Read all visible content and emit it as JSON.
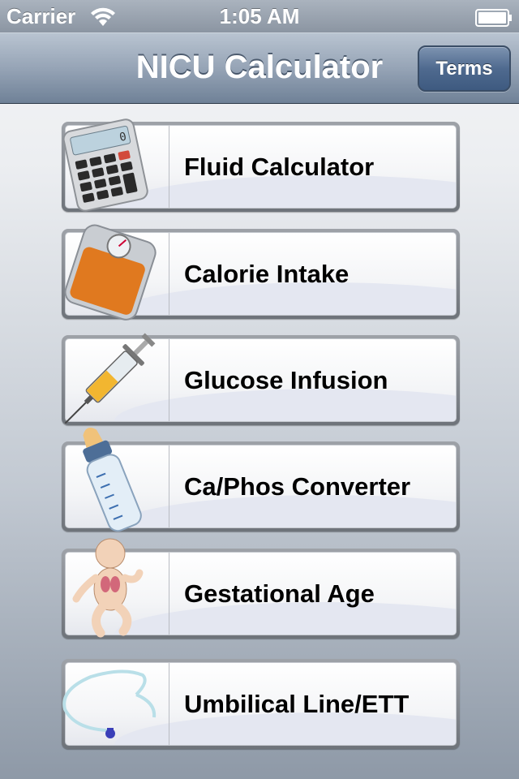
{
  "status_bar": {
    "carrier": "Carrier",
    "time": "1:05 AM"
  },
  "nav": {
    "title": "NICU Calculator",
    "terms_label": "Terms"
  },
  "menu": {
    "items": [
      {
        "label": "Fluid Calculator",
        "icon": "calculator-icon"
      },
      {
        "label": "Calorie Intake",
        "icon": "scale-icon"
      },
      {
        "label": "Glucose Infusion",
        "icon": "syringe-icon"
      },
      {
        "label": "Ca/Phos Converter",
        "icon": "baby-bottle-icon"
      },
      {
        "label": "Gestational Age",
        "icon": "baby-icon"
      },
      {
        "label": "Umbilical Line/ETT",
        "icon": "catheter-icon"
      }
    ]
  },
  "colors": {
    "nav_accent": "#6f8197",
    "button_blue": "#4f6a8f"
  }
}
